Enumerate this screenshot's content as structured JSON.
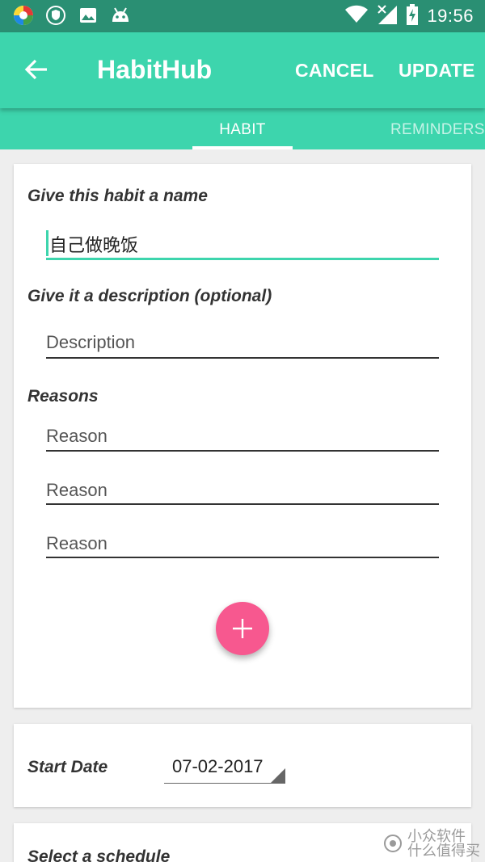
{
  "status_bar": {
    "time": "19:56",
    "icons": [
      "colorful-app-icon",
      "shield-icon",
      "image-icon",
      "android-head-icon",
      "wifi-icon",
      "no-signal-icon",
      "battery-charging-icon"
    ]
  },
  "app_bar": {
    "title": "HabitHub",
    "cancel_label": "CANCEL",
    "update_label": "UPDATE",
    "colors": {
      "primary": "#3dd5ad",
      "status": "#2a8f73",
      "accent": "#f7588f"
    }
  },
  "tabs": [
    {
      "label": "HABIT",
      "selected": true
    },
    {
      "label": "REMINDERS",
      "selected": false
    }
  ],
  "form": {
    "name_label": "Give this habit a name",
    "name_value": "自己做晚饭",
    "description_label": "Give it a description (optional)",
    "description_placeholder": "Description",
    "reasons_label": "Reasons",
    "reason_placeholders": [
      "Reason",
      "Reason",
      "Reason"
    ],
    "add_icon": "plus-icon"
  },
  "start_date": {
    "label": "Start Date",
    "value": "07-02-2017"
  },
  "schedule": {
    "label": "Select a schedule"
  },
  "watermark": {
    "line1": "小众软件",
    "line2": "什么值得买"
  }
}
